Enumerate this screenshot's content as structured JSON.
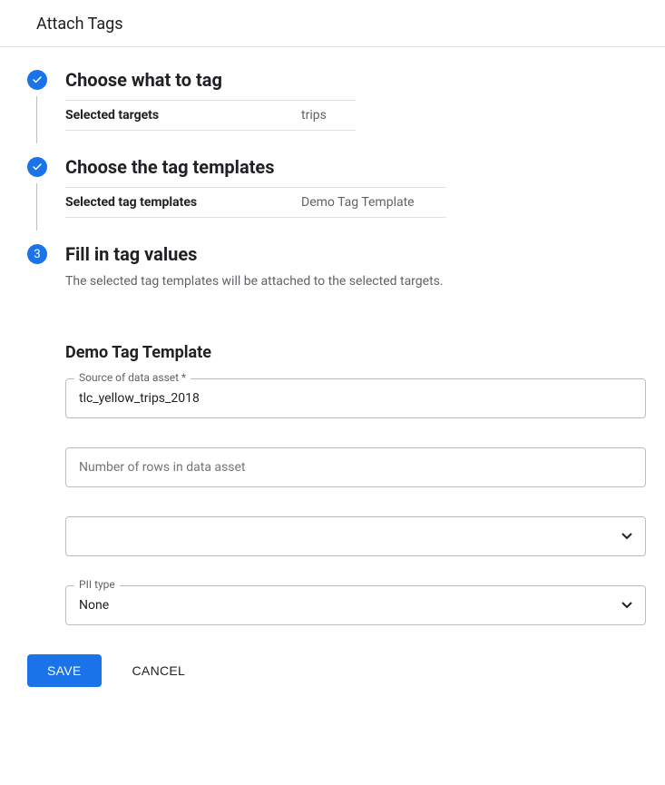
{
  "header": {
    "title": "Attach Tags"
  },
  "steps": {
    "s1": {
      "title": "Choose what to tag",
      "summary_label": "Selected targets",
      "summary_value": "trips"
    },
    "s2": {
      "title": "Choose the tag templates",
      "summary_label": "Selected tag templates",
      "summary_value": "Demo Tag Template"
    },
    "s3": {
      "number": "3",
      "title": "Fill in tag values",
      "description": "The selected tag templates will be attached to the selected targets."
    }
  },
  "form": {
    "section_title": "Demo Tag Template",
    "source": {
      "label": "Source of data asset *",
      "value": "tlc_yellow_trips_2018"
    },
    "rows": {
      "placeholder": "Number of rows in data asset",
      "value": ""
    },
    "unnamed_select": {
      "value": ""
    },
    "pii": {
      "label": "PII type",
      "value": "None"
    }
  },
  "actions": {
    "save": "SAVE",
    "cancel": "CANCEL"
  }
}
